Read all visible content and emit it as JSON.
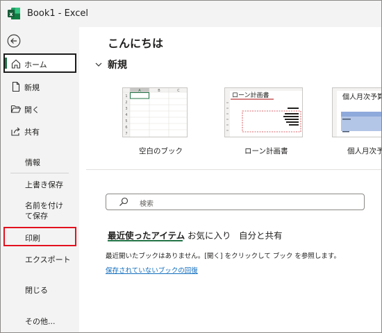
{
  "titlebar": {
    "title": "Book1  -  Excel",
    "app_icon": "excel-icon"
  },
  "sidebar": {
    "back_icon": "back-arrow-icon",
    "items": [
      {
        "label": "ホーム",
        "icon": "home-icon"
      },
      {
        "label": "新規",
        "icon": "new-document-icon"
      },
      {
        "label": "開く",
        "icon": "open-folder-icon"
      },
      {
        "label": "共有",
        "icon": "share-icon"
      },
      {
        "label": "情報"
      },
      {
        "label": "上書き保存"
      },
      {
        "label": "名前を付けて保存"
      },
      {
        "label": "印刷"
      },
      {
        "label": "エクスポート"
      },
      {
        "label": "閉じる"
      },
      {
        "label": "その他..."
      }
    ]
  },
  "main": {
    "greeting": "こんにちは",
    "new_section": {
      "title": "新規",
      "icon": "chevron-down-icon"
    },
    "templates": [
      {
        "label": "空白のブック",
        "header_cell": "A",
        "cols": [
          "A",
          "B",
          "C"
        ],
        "rows": [
          "1",
          "2",
          "3",
          "4",
          "5",
          "6",
          "7"
        ]
      },
      {
        "label": "ローン計画書",
        "thumb_title": "ローン計画書"
      },
      {
        "label": "個人月次予算",
        "thumb_title": "個人月次予算"
      }
    ],
    "search": {
      "placeholder": "検索",
      "icon": "search-icon"
    },
    "tabs": [
      {
        "label": "最近使ったアイテム",
        "active": true
      },
      {
        "label": "お気に入り",
        "active": false
      },
      {
        "label": "自分と共有",
        "active": false
      }
    ],
    "empty_message": "最近開いたブックはありません。[開く] をクリックして ブック を参照します。",
    "recover_link": "保存されていないブックの回復"
  },
  "colors": {
    "excel_green": "#217346",
    "highlight_red": "#e3101e",
    "link_blue": "#0f6cbd"
  }
}
